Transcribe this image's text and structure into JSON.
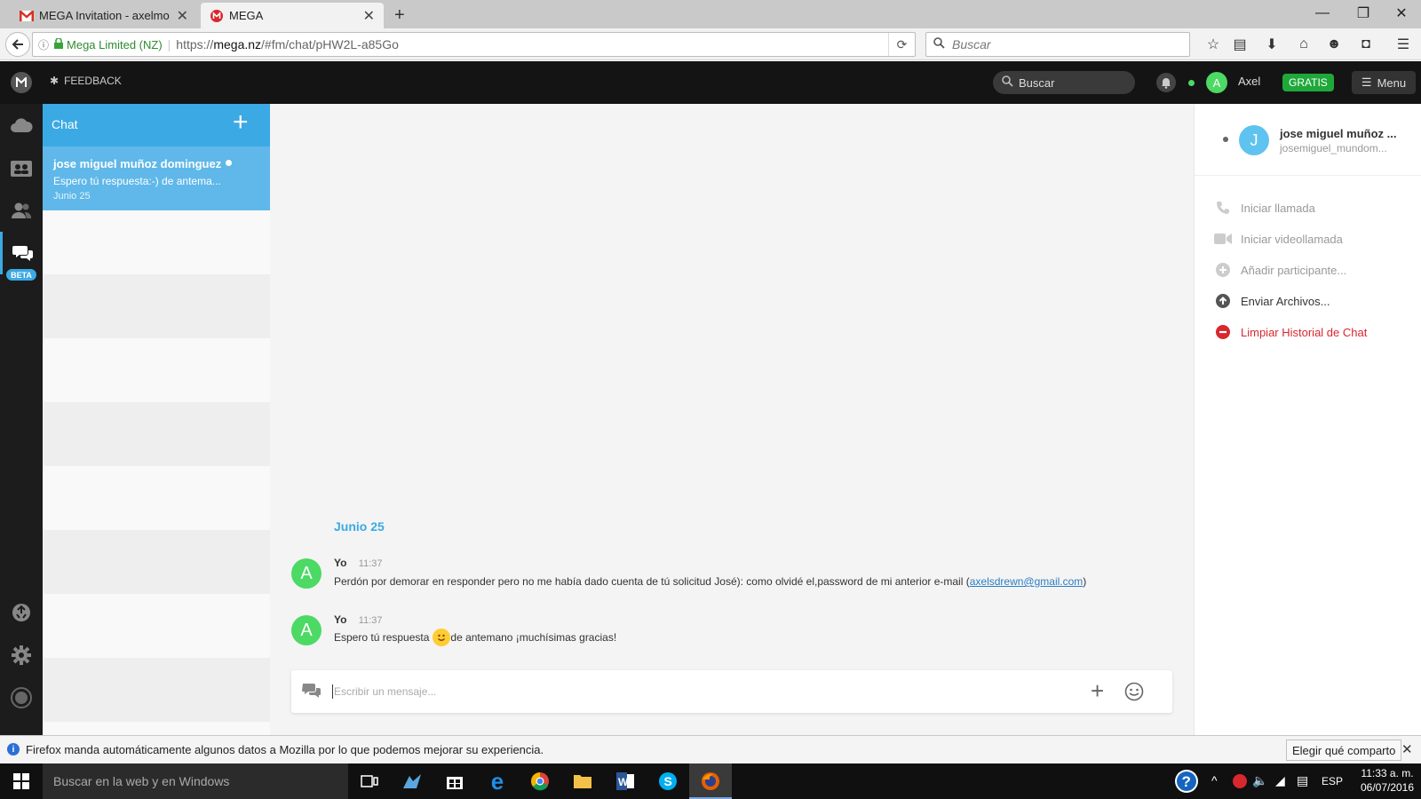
{
  "browser": {
    "tabs": [
      {
        "title": "MEGA Invitation - axelmor...",
        "icon": "gmail-icon",
        "active": false
      },
      {
        "title": "MEGA",
        "icon": "mega-icon",
        "active": true
      }
    ],
    "new_tab_label": "+",
    "identity_label": "Mega Limited (NZ)",
    "url_prefix": "https://",
    "url_domain": "mega.nz",
    "url_path": "/#fm/chat/pHW2L-a85Go",
    "search_placeholder": "Buscar"
  },
  "header": {
    "feedback_label": "FEEDBACK",
    "search_placeholder": "Buscar",
    "user_initial": "A",
    "user_name": "Axel",
    "plan_badge": "GRATIS",
    "menu_label": "Menu",
    "colors": {
      "accent": "#3ba9e4",
      "plan": "#1fa83a",
      "online": "#4cd964"
    }
  },
  "sidebar": {
    "beta_badge": "BETA",
    "icons": [
      "cloud-drive-icon",
      "shared-folders-icon",
      "contacts-icon",
      "chat-icon",
      "rubbish-bin-icon",
      "settings-icon",
      "transfers-icon"
    ]
  },
  "chat_list": {
    "title": "Chat",
    "add_label": "+",
    "items": [
      {
        "name": "jose miguel muñoz dominguez",
        "preview": "Espero tú respuesta:-) de antema...",
        "date": "Junio 25"
      }
    ]
  },
  "conversation": {
    "date_divider": "Junio 25",
    "messages": [
      {
        "avatar": "A",
        "author": "Yo",
        "time": "11:37",
        "text": "Perdón por demorar en responder pero no me había dado cuenta de tú solicitud José): como olvidé el,password de mi anterior e-mail (",
        "link": "axelsdrewn@gmail.com",
        "text_after": ")"
      },
      {
        "avatar": "A",
        "author": "Yo",
        "time": "11:37",
        "text": "Espero tú respuesta",
        "emoji": "🙂",
        "text_after": " de antemano ¡muchísimas gracias!"
      }
    ],
    "composer_placeholder": "Escribir un mensaje..."
  },
  "contact_panel": {
    "avatar": "J",
    "name": "jose miguel muñoz ...",
    "email": "josemiguel_mundom...",
    "actions": [
      {
        "label": "Iniciar llamada",
        "icon": "phone-icon",
        "enabled": false
      },
      {
        "label": "Iniciar videollamada",
        "icon": "video-camera-icon",
        "enabled": false
      },
      {
        "label": "Añadir participante...",
        "icon": "add-circle-icon",
        "enabled": false
      },
      {
        "label": "Enviar Archivos...",
        "icon": "upload-icon",
        "enabled": true
      },
      {
        "label": "Limpiar Historial de Chat",
        "icon": "clear-history-icon",
        "enabled": true,
        "danger": true
      }
    ]
  },
  "notification_bar": {
    "message": "Firefox manda automáticamente algunos datos a Mozilla por lo que podemos mejorar su experiencia.",
    "button_label": "Elegir qué comparto"
  },
  "taskbar": {
    "search_placeholder": "Buscar en la web y en Windows",
    "language": "ESP",
    "time": "11:33 a. m.",
    "date": "06/07/2016"
  }
}
